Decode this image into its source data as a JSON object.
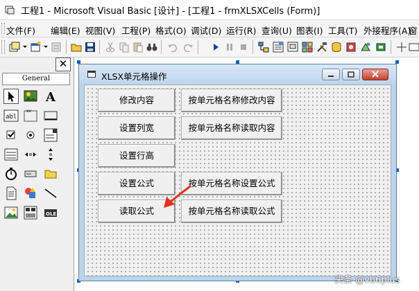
{
  "window": {
    "title": "工程1 - Microsoft Visual Basic [设计] - [工程1 - frmXLSXCells (Form)]"
  },
  "menu": {
    "items": [
      {
        "label": "文件(F)"
      },
      {
        "label": "编辑(E)"
      },
      {
        "label": "视图(V)"
      },
      {
        "label": "工程(P)"
      },
      {
        "label": "格式(O)"
      },
      {
        "label": "调试(D)"
      },
      {
        "label": "运行(R)"
      },
      {
        "label": "查询(U)"
      },
      {
        "label": "图表(I)"
      },
      {
        "label": "工具(T)"
      },
      {
        "label": "外接程序(A)"
      },
      {
        "label": "窗"
      }
    ]
  },
  "toolbox": {
    "tab_label": "General",
    "close_label": "✕"
  },
  "form": {
    "caption": "XLSX单元格操作",
    "buttons": {
      "modify_content": "修改内容",
      "modify_by_name": "按单元格名称修改内容",
      "set_col_width": "设置列宽",
      "read_by_name": "按单元格名称读取内容",
      "set_row_height": "设置行高",
      "set_formula": "设置公式",
      "set_formula_by_name": "按单元格名称设置公式",
      "read_formula": "读取公式",
      "read_formula_by_name": "按单元格名称读取公式"
    }
  },
  "watermark": "头条 @vb6plus",
  "colors": {
    "accent_arrow": "#e8301d",
    "selection_handle": "#1f5fbf"
  }
}
